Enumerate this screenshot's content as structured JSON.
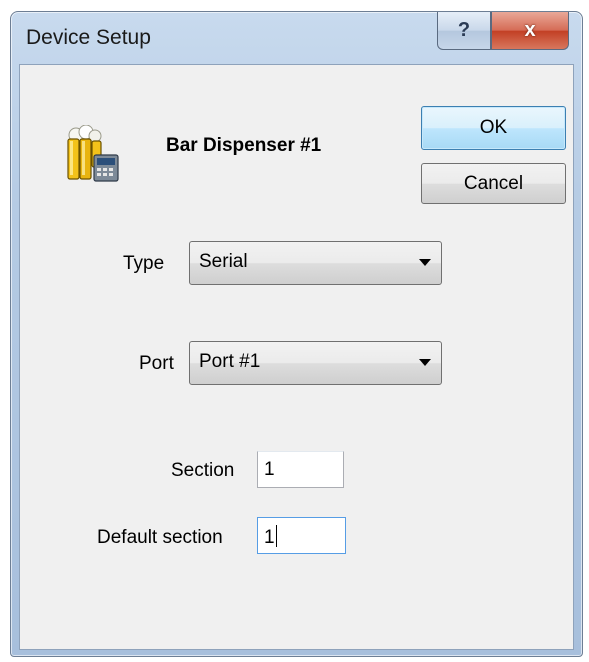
{
  "window": {
    "title": "Device Setup",
    "help_glyph": "?",
    "close_glyph": "x"
  },
  "header": {
    "icon": "beer-dispenser-icon",
    "device_name": "Bar Dispenser #1"
  },
  "buttons": {
    "ok_label": "OK",
    "cancel_label": "Cancel"
  },
  "form": {
    "type": {
      "label": "Type",
      "value": "Serial"
    },
    "port": {
      "label": "Port",
      "value": "Port #1"
    },
    "section": {
      "label": "Section",
      "value": "1"
    },
    "default_section": {
      "label": "Default section",
      "value": "1"
    }
  },
  "colors": {
    "frame": "#b5cbe4",
    "client": "#f0f0f0",
    "ok_focus": "#3c7fb1",
    "close_button": "#c23f24"
  }
}
